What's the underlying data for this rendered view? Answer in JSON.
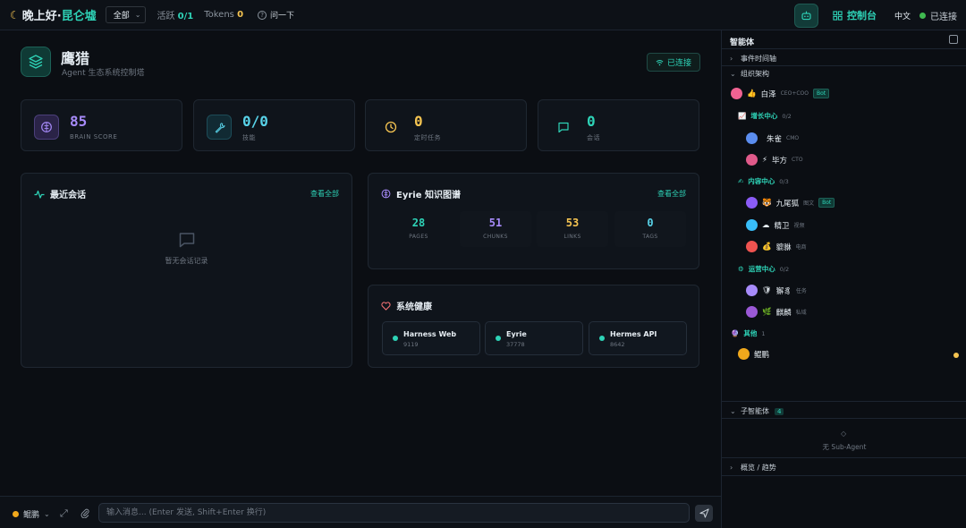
{
  "topbar": {
    "greeting": "晚上好·",
    "app_name": "昆仑墟",
    "scope_selected": "全部",
    "active_label": "活跃",
    "active_value": "0/1",
    "tokens_label": "Tokens",
    "tokens_value": "0",
    "ask_label": "问一下",
    "console_label": "控制台",
    "language": "中文",
    "connection_status": "已连接"
  },
  "hero": {
    "title": "鹰猎",
    "subtitle": "Agent 生态系统控制塔",
    "connection_button": "已连接"
  },
  "stats": [
    {
      "value": "85",
      "label": "BRAIN SCORE",
      "color": "#a78bfa",
      "icon": "brain-icon"
    },
    {
      "value": "0/0",
      "label": "技能",
      "color": "#58d2e8",
      "icon": "wrench-icon"
    },
    {
      "value": "0",
      "label": "定时任务",
      "color": "#f5c451",
      "icon": "clock-icon"
    },
    {
      "value": "0",
      "label": "会话",
      "color": "#2ed3b7",
      "icon": "chat-icon"
    }
  ],
  "recent_sessions": {
    "title": "最近会话",
    "view_all": "查看全部",
    "empty_text": "暂无会话记录"
  },
  "knowledge_graph": {
    "title": "Eyrie 知识图谱",
    "view_all": "查看全部",
    "metrics": [
      {
        "value": "28",
        "label": "PAGES",
        "color": "#2ed3b7"
      },
      {
        "value": "51",
        "label": "CHUNKS",
        "color": "#a78bfa"
      },
      {
        "value": "53",
        "label": "LINKS",
        "color": "#f5c451"
      },
      {
        "value": "0",
        "label": "TAGS",
        "color": "#58d2e8"
      }
    ]
  },
  "health": {
    "title": "系统健康",
    "services": [
      {
        "name": "Harness Web",
        "port": "9119"
      },
      {
        "name": "Eyrie",
        "port": "37778"
      },
      {
        "name": "Hermes API",
        "port": "8642"
      }
    ]
  },
  "composer": {
    "agent_name": "鲲鹏",
    "placeholder": "输入消息... (Enter 发送, Shift+Enter 换行)"
  },
  "sidebar": {
    "title": "智能体",
    "timeline_label": "事件时间轴",
    "org_label": "组织架构",
    "ceo": {
      "emoji": "👍",
      "name": "白泽",
      "role": "CEO+COO",
      "badge": "Bot"
    },
    "groups": [
      {
        "emoji": "📈",
        "name": "增长中心",
        "count": "0/2",
        "members": [
          {
            "emoji": "",
            "name": "朱雀",
            "role": "CMO"
          },
          {
            "emoji": "⚡",
            "name": "毕方",
            "role": "CTO"
          }
        ]
      },
      {
        "emoji": "✍",
        "name": "内容中心",
        "count": "0/3",
        "members": [
          {
            "emoji": "🐯",
            "name": "九尾狐",
            "role": "图文",
            "badge": "Bot"
          },
          {
            "emoji": "☁",
            "name": "精卫",
            "role": "视频"
          },
          {
            "emoji": "💰",
            "name": "貔貅",
            "role": "电商"
          }
        ]
      },
      {
        "emoji": "⚙",
        "name": "运营中心",
        "count": "0/2",
        "members": [
          {
            "emoji": "🛡",
            "name": "獬豸",
            "role": "任务"
          },
          {
            "emoji": "🌿",
            "name": "麒麟",
            "role": "私域"
          }
        ]
      }
    ],
    "other_group": {
      "emoji": "🔮",
      "name": "其他",
      "count": "1"
    },
    "other_member": {
      "name": "鲲鹏"
    },
    "sub_agents_label": "子智能体",
    "sub_agents_count": "4",
    "sub_agents_empty": "无 Sub-Agent",
    "overview_label": "概览 / 趋势"
  }
}
